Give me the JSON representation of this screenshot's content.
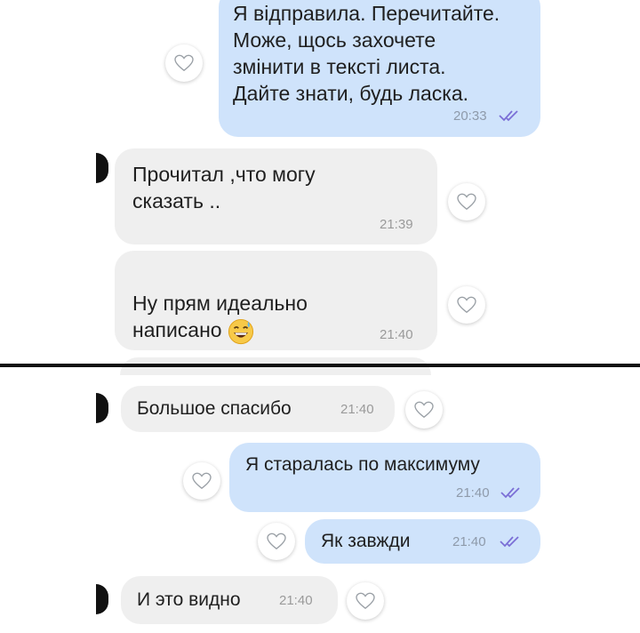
{
  "messages": [
    {
      "side": "out",
      "text": "Я відправила. Перечитайте.\nМоже, щось захочете\nзмінити в тексті листа.\nДайте знати, будь ласка.",
      "time": "20:33"
    },
    {
      "side": "in",
      "text": "Прочитал ,что могу\nсказать ..",
      "time": "21:39"
    },
    {
      "side": "in",
      "text": "Ну прям идеально\nнаписано",
      "emoji": "grinning-sweat-emoji",
      "time": "21:40"
    },
    {
      "side": "in",
      "text": "Большое спасибо",
      "time": "21:40"
    },
    {
      "side": "out",
      "text": "Я старалась по максимуму",
      "time": "21:40"
    },
    {
      "side": "out",
      "text": "Як завжди",
      "time": "21:40"
    },
    {
      "side": "in",
      "text": "И это видно",
      "time": "21:40"
    }
  ],
  "colors": {
    "outgoing_bubble": "#cfe3fb",
    "incoming_bubble": "#efefef",
    "read_ticks": "#7b6fd6",
    "divider": "#111111"
  },
  "icons": {
    "reaction": "heart-outline-icon",
    "read_status": "double-check-icon",
    "sender_avatar": "avatar-edge"
  }
}
